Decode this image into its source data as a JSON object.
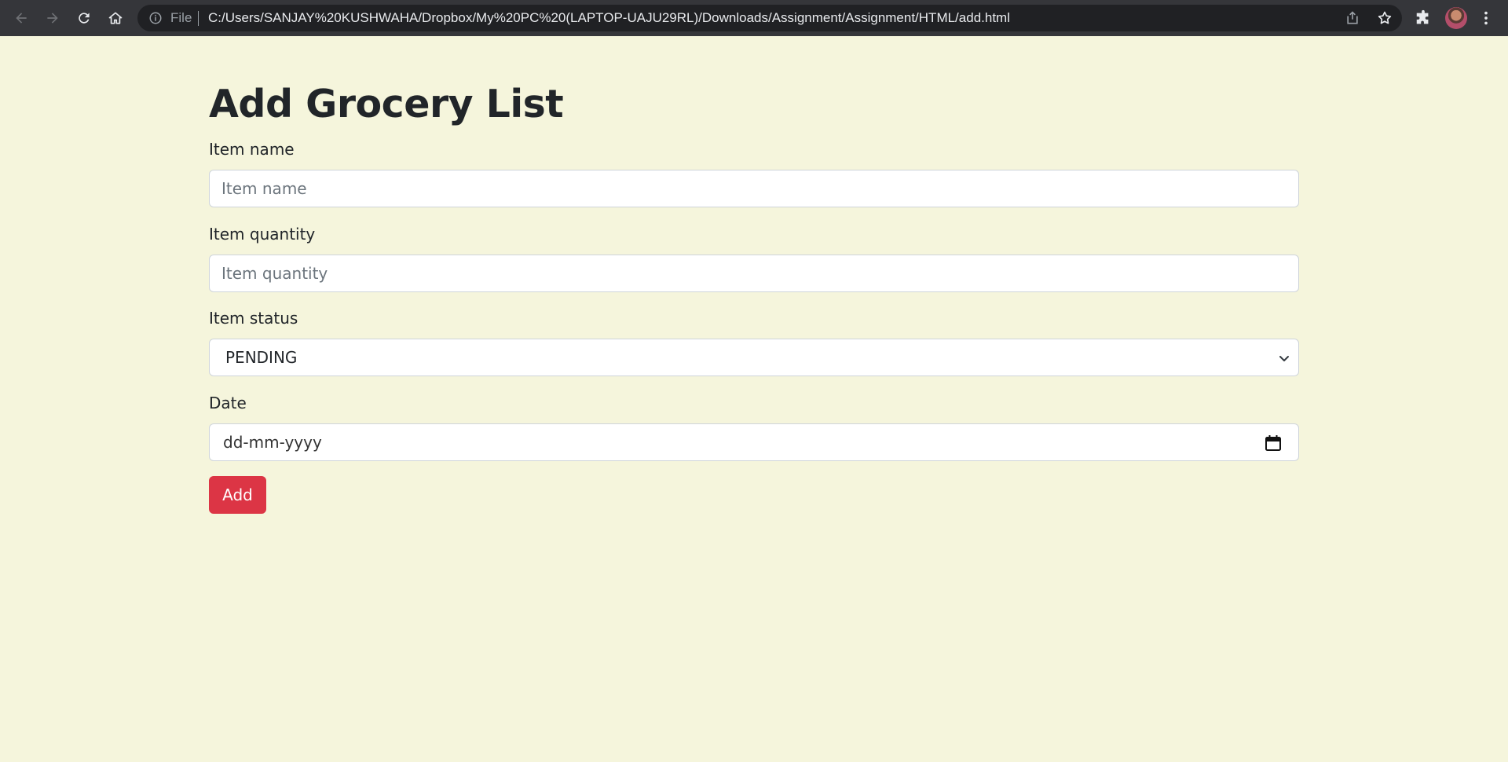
{
  "browser": {
    "scheme_label": "File",
    "url": "C:/Users/SANJAY%20KUSHWAHA/Dropbox/My%20PC%20(LAPTOP-UAJU29RL)/Downloads/Assignment/Assignment/HTML/add.html"
  },
  "page": {
    "title": "Add Grocery List"
  },
  "form": {
    "item_name": {
      "label": "Item name",
      "placeholder": "Item name",
      "value": ""
    },
    "item_quantity": {
      "label": "Item quantity",
      "placeholder": "Item quantity",
      "value": ""
    },
    "item_status": {
      "label": "Item status",
      "selected": "PENDING"
    },
    "date": {
      "label": "Date",
      "value": "dd-mm-yyyy"
    },
    "submit_label": "Add"
  },
  "colors": {
    "page_background": "#f5f5dc",
    "button_danger": "#dc3545",
    "toolbar": "#35363a"
  }
}
